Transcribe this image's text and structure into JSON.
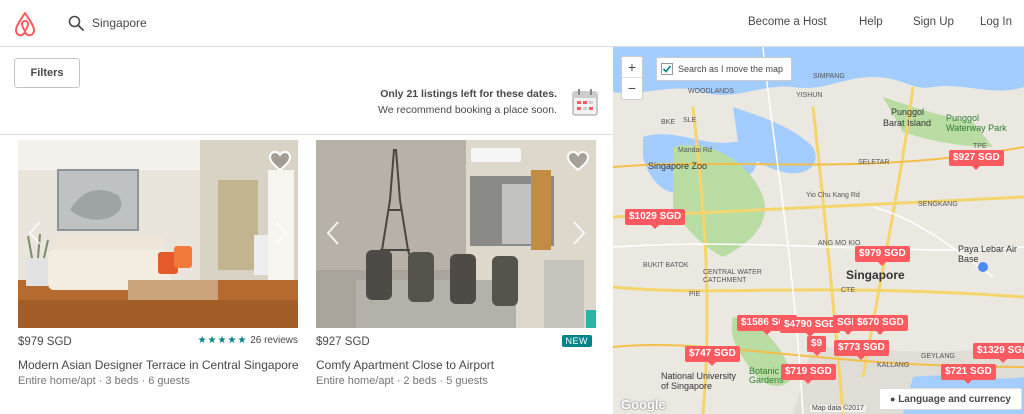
{
  "header": {
    "search_value": "Singapore",
    "nav": [
      "Become a Host",
      "Help",
      "Sign Up",
      "Log In"
    ]
  },
  "toolbar": {
    "filters_label": "Filters",
    "scarcity_line1": "Only 21 listings left for these dates.",
    "scarcity_line2": "We recommend booking a place soon."
  },
  "listings": [
    {
      "price": "$979 SGD",
      "rating_stars": 5,
      "reviews": "26 reviews",
      "title": "Modern Asian Designer Terrace in Central Singapore",
      "details": "Entire home/apt · 3 beds · 6 guests"
    },
    {
      "price": "$927 SGD",
      "badge": "NEW",
      "title": "Comfy Apartment Close to Airport",
      "details": "Entire home/apt · 2 beds · 5 guests"
    }
  ],
  "map": {
    "zoom_in": "+",
    "zoom_out": "−",
    "search_toggle_label": "Search as I move the map",
    "language_button": "Language and currency",
    "attribution": "Map data ©2017",
    "google": "Google",
    "pins": [
      "$927 SGD",
      "$1029 SGD",
      "$979 SGD",
      "$1586 SGD",
      "$4790 SGD",
      "SGD",
      "$670 SGD",
      "$9",
      "$773 SGD",
      "$747 SGD",
      "$719 SGD",
      "$1329 SGD",
      "$721 SGD"
    ],
    "labels": [
      "SIMPANG",
      "WOODLANDS",
      "YISHUN",
      "Punggol",
      "Barat Island",
      "Punggol Waterway Park",
      "Singapore Zoo",
      "Mandai Rd",
      "SELETAR",
      "SENGKANG",
      "Yio Chu Kang Rd",
      "ANG MO KIO",
      "Paya Lebar Air Base",
      "BUKIT BATOK",
      "CENTRAL WATER CATCHMENT",
      "Singapore",
      "Botanic Gardens",
      "National University of Singapore",
      "GEYLANG",
      "KALLANG",
      "TPE",
      "BKE",
      "PIE",
      "SLE",
      "CTE"
    ],
    "colors": {
      "pin": "#ff5a5f",
      "water": "#a3ccff",
      "park": "#b9dca3",
      "road": "#f5d56b"
    }
  }
}
